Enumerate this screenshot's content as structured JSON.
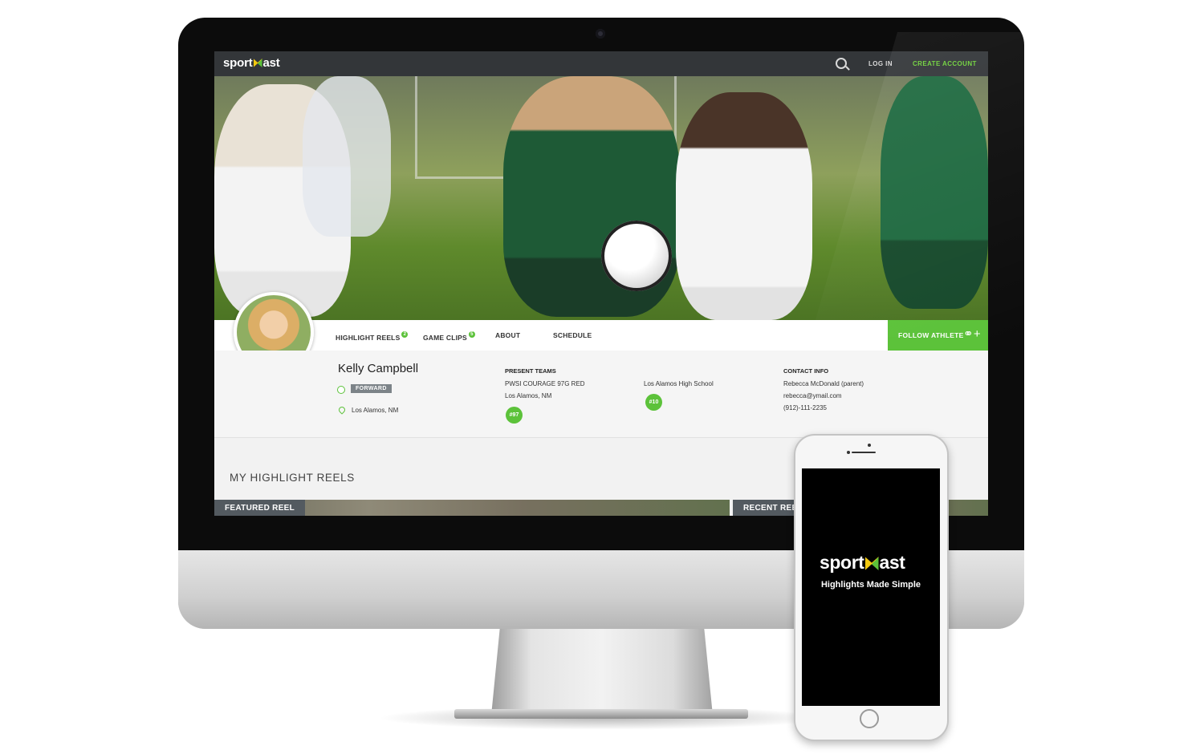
{
  "brand": {
    "name_left": "sport",
    "name_right": "ast"
  },
  "topnav": {
    "login": "LOG IN",
    "create_account": "CREATE ACCOUNT"
  },
  "tabs": [
    {
      "label": "HIGHLIGHT REELS",
      "badge": "2"
    },
    {
      "label": "GAME CLIPS",
      "badge": "5"
    },
    {
      "label": "ABOUT"
    },
    {
      "label": "SCHEDULE"
    }
  ],
  "follow_button": {
    "label": "FOLLOW ATHLETE",
    "icon": "add-person-icon"
  },
  "athlete": {
    "name": "Kelly Campbell",
    "position": "FORWARD",
    "location": "Los Alamos, NM"
  },
  "present_teams": {
    "heading": "PRESENT TEAMS",
    "teams": [
      {
        "name": "PWSI COURAGE 97G RED",
        "location": "Los Alamos, NM",
        "number": "#97"
      },
      {
        "name": "Los Alamos High School",
        "number": "#10"
      }
    ]
  },
  "contact": {
    "heading": "CONTACT INFO",
    "name": "Rebecca McDonald (parent)",
    "email": "rebecca@ymail.com",
    "phone": "(912)-111-2235"
  },
  "reels": {
    "title": "MY HIGHLIGHT REELS",
    "featured_label": "FEATURED REEL",
    "recent_label": "RECENT REEL"
  },
  "mobile": {
    "tagline": "Highlights Made Simple"
  },
  "colors": {
    "accent": "#5cc23a",
    "nav_bg": "#333639",
    "brand_yellow": "#f2c80f"
  }
}
